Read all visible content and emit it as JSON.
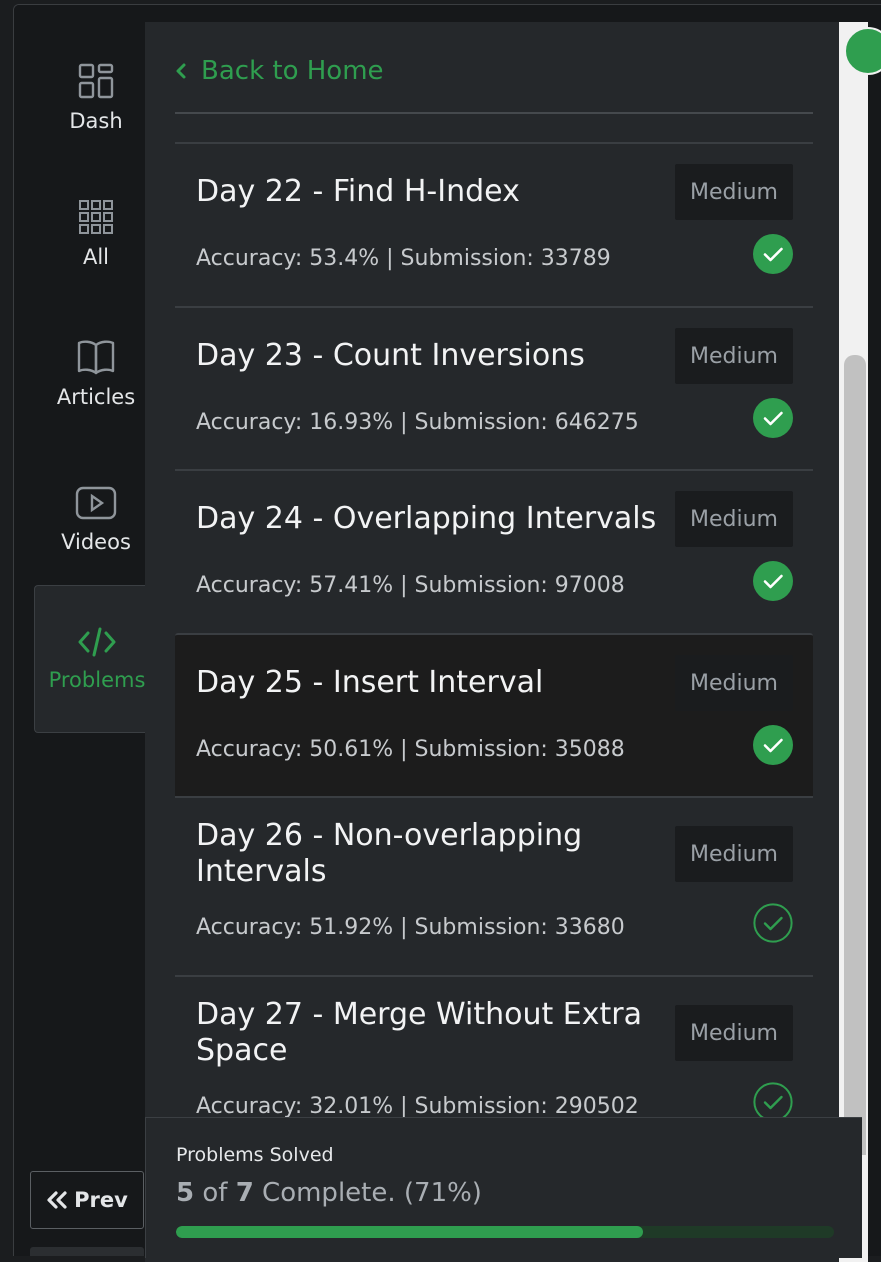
{
  "sidebar": {
    "items": [
      {
        "label": "Dash",
        "icon": "dashboard-icon"
      },
      {
        "label": "All",
        "icon": "grid-icon"
      },
      {
        "label": "Articles",
        "icon": "book-icon"
      },
      {
        "label": "Videos",
        "icon": "video-icon"
      },
      {
        "label": "Problems",
        "icon": "code-icon",
        "active": true
      }
    ],
    "prev_label": "Prev"
  },
  "panel": {
    "back_label": "Back to Home",
    "problems": [
      {
        "title": "Day 22 - Find H-Index",
        "meta": "Accuracy: 53.4% | Submission: 33789",
        "difficulty": "Medium",
        "status": "solved"
      },
      {
        "title": "Day 23 - Count Inversions",
        "meta": "Accuracy: 16.93% | Submission: 646275",
        "difficulty": "Medium",
        "status": "solved"
      },
      {
        "title": "Day 24 - Overlapping Intervals",
        "meta": "Accuracy: 57.41% | Submission: 97008",
        "difficulty": "Medium",
        "status": "solved"
      },
      {
        "title": "Day 25 - Insert Interval",
        "meta": "Accuracy: 50.61% | Submission: 35088",
        "difficulty": "Medium",
        "status": "solved"
      },
      {
        "title": "Day 26 - Non-overlapping Intervals",
        "meta": "Accuracy: 51.92% | Submission: 33680",
        "difficulty": "Medium",
        "status": "unsolved"
      },
      {
        "title": "Day 27 - Merge Without Extra Space",
        "meta": "Accuracy: 32.01% | Submission: 290502",
        "difficulty": "Medium",
        "status": "unsolved"
      }
    ]
  },
  "footer": {
    "label": "Problems Solved",
    "solved": "5",
    "of_text": "of",
    "total": "7",
    "suffix": "Complete. (71%)",
    "progress_fraction": 0.71
  },
  "colors": {
    "accent": "#2f9e4f",
    "background": "#25282b"
  }
}
